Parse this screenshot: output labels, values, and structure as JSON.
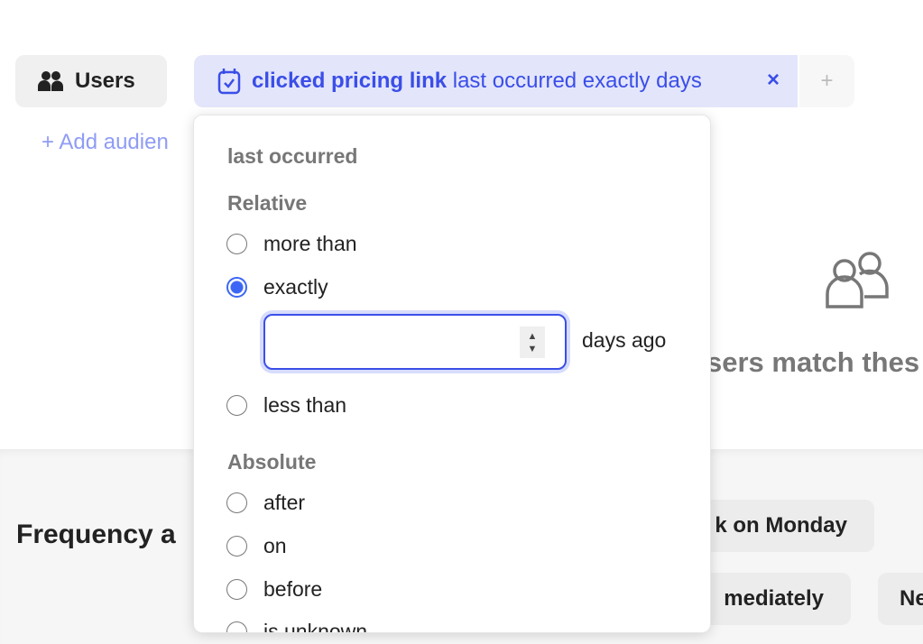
{
  "header": {
    "users_label": "Users",
    "filter": {
      "event": "clicked pricing link",
      "condition": "last occurred exactly days"
    },
    "add_filter": "+",
    "close": "×",
    "add_audience": "+ Add audien"
  },
  "empty_state": {
    "icon": "users-outline-icon",
    "text": "sers match thes"
  },
  "lower": {
    "title": "Frequency a",
    "options": [
      "k on Monday",
      "mediately",
      "Ne"
    ]
  },
  "popover": {
    "title": "last occurred",
    "relative_header": "Relative",
    "relative_options": [
      {
        "label": "more than",
        "selected": false
      },
      {
        "label": "exactly",
        "selected": true
      },
      {
        "label": "less than",
        "selected": false
      }
    ],
    "days_input": {
      "value": "",
      "suffix": "days ago"
    },
    "absolute_header": "Absolute",
    "absolute_options": [
      {
        "label": "after",
        "selected": false
      },
      {
        "label": "on",
        "selected": false
      },
      {
        "label": "before",
        "selected": false
      },
      {
        "label": "is unknown",
        "selected": false
      }
    ]
  },
  "colors": {
    "accent": "#3a4ee8",
    "chip_bg": "#e3e5fb",
    "radio_selected": "#3b66f5"
  }
}
